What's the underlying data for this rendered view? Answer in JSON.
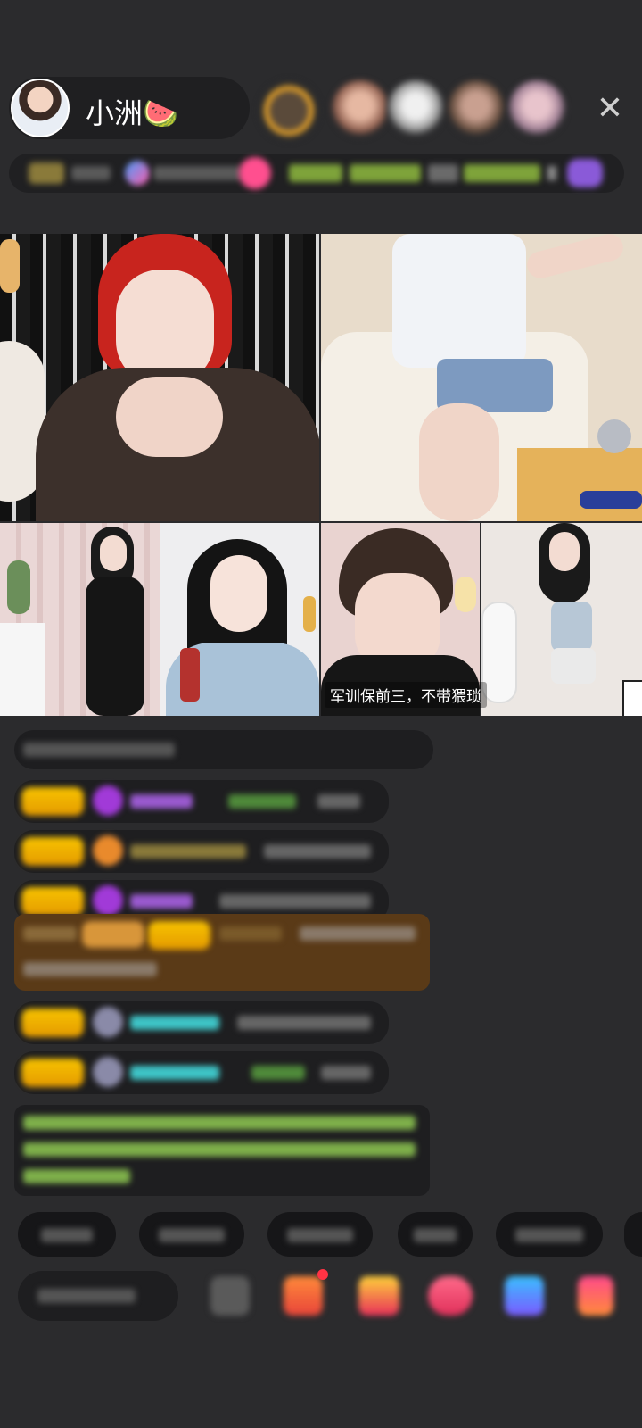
{
  "header": {
    "host_name": "小洲🍉"
  },
  "grid": {
    "caption_bottom_right_tile": "军训保前三，不带猥琐"
  },
  "colors": {
    "background": "#2b2b2d",
    "badge_gold": "#f2b400",
    "highlight_brown": "#5a3a17",
    "chat_green_text": "#8fd14f",
    "chat_teal_name": "#3ec3c6",
    "chat_purple_name": "#b46cff"
  },
  "icons": [
    "close-icon",
    "gift-icon",
    "red-gift-icon",
    "blue-gift-icon",
    "more-icon"
  ]
}
